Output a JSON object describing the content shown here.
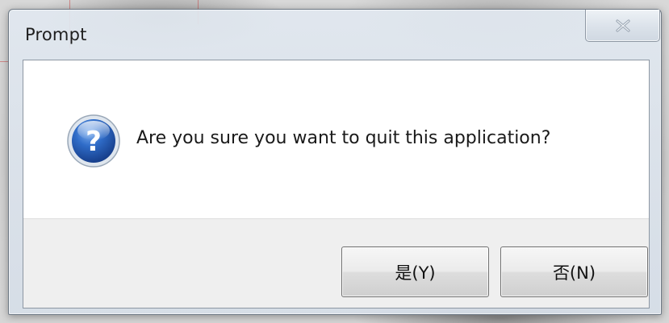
{
  "dialog": {
    "title": "Prompt",
    "close_icon": "close-x-icon",
    "message": "Are you sure you want to quit this application?",
    "message_icon": "question-icon",
    "buttons": {
      "yes_label": "是(Y)",
      "no_label": "否(N)"
    }
  },
  "colors": {
    "question_icon_blue": "#2a5fb8",
    "button_face": "#e6e6e6",
    "button_area": "#efefef",
    "client_background": "#ffffff"
  }
}
